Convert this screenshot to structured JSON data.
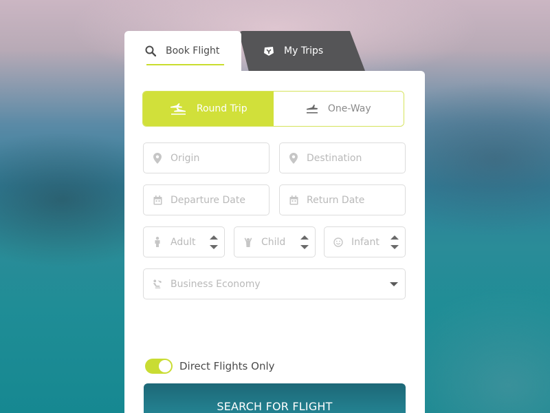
{
  "tabs": {
    "book_flight": "Book Flight",
    "my_trips": "My Trips"
  },
  "trip_type": {
    "round_trip": "Round Trip",
    "one_way": "One-Way",
    "selected": "Round Trip"
  },
  "fields": {
    "origin": "Origin",
    "destination": "Destination",
    "departure_date": "Departure Date",
    "return_date": "Return Date",
    "adult": "Adult",
    "child": "Child",
    "infant": "Infant",
    "cabin_class": "Business Economy"
  },
  "options": {
    "direct_flights_label": "Direct Flights Only",
    "direct_flights_on": true
  },
  "actions": {
    "search": "SEARCH FOR FLIGHT"
  },
  "colors": {
    "accent": "#d1e03a",
    "primary_button": "#23808f",
    "tab_dark": "#555557"
  }
}
